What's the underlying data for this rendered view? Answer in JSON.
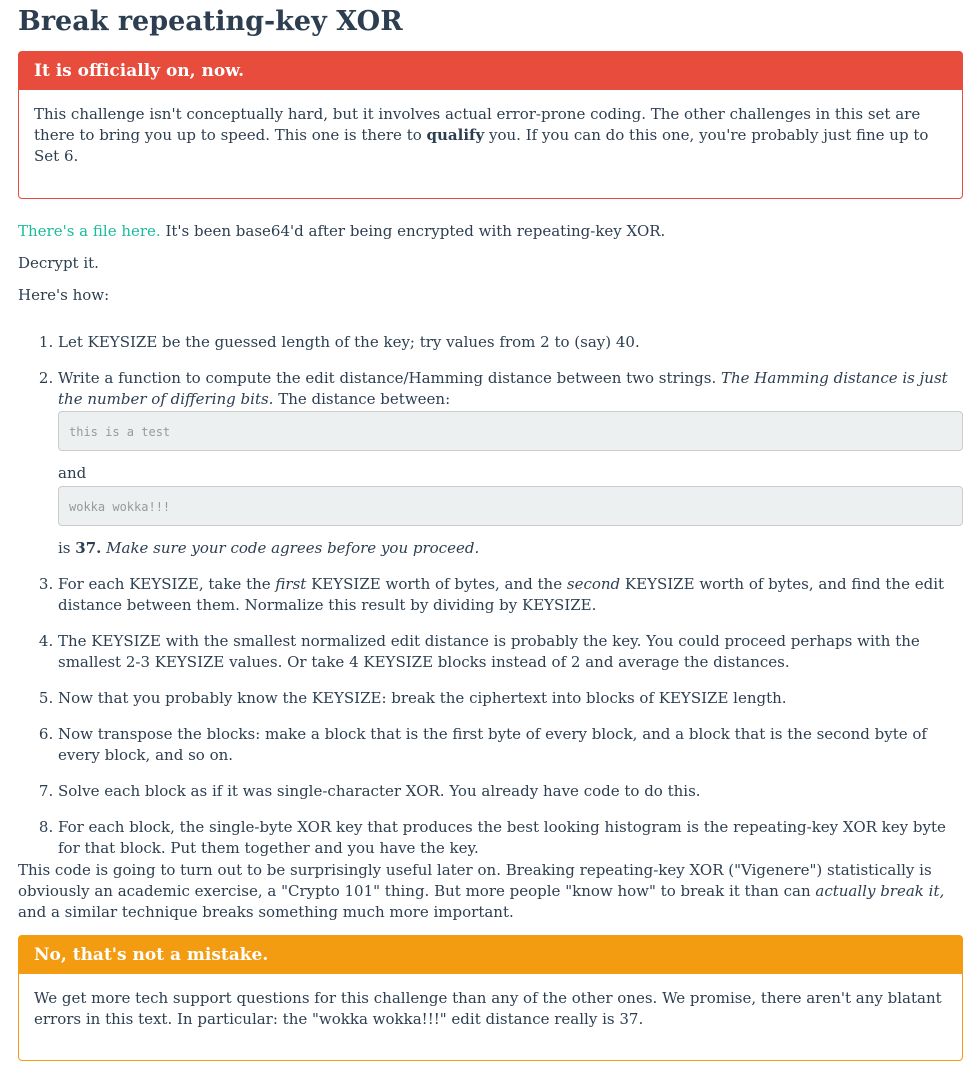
{
  "title": "Break repeating-key XOR",
  "danger_panel": {
    "heading": "It is officially on, now.",
    "body_before": "This challenge isn't conceptually hard, but it involves actual error-prone coding. The other challenges in this set are there to bring you up to speed. This one is there to ",
    "body_bold": "qualify",
    "body_after": " you. If you can do this one, you're probably just fine up to Set 6."
  },
  "intro": {
    "link_text": "There's a file here.",
    "line1_rest": " It's been base64'd after being encrypted with repeating-key XOR.",
    "line2": "Decrypt it.",
    "line3": "Here's how:"
  },
  "steps": {
    "s1": "Let KEYSIZE be the guessed length of the key; try values from 2 to (say) 40.",
    "s2_text": "Write a function to compute the edit distance/Hamming distance between two strings. ",
    "s2_italic": "The Hamming distance is just the number of differing bits.",
    "s2_after": " The distance between:",
    "s2_code1": "this is a test",
    "s2_and": "and",
    "s2_code2": "wokka wokka!!!",
    "s2_is": "is ",
    "s2_num": "37.",
    "s2_tail": " Make sure your code agrees before you proceed.",
    "s3_a": "For each KEYSIZE, take the ",
    "s3_first": "first",
    "s3_b": " KEYSIZE worth of bytes, and the ",
    "s3_second": "second",
    "s3_c": " KEYSIZE worth of bytes, and find the edit distance between them. Normalize this result by dividing by KEYSIZE.",
    "s4": "The KEYSIZE with the smallest normalized edit distance is probably the key. You could proceed perhaps with the smallest 2-3 KEYSIZE values. Or take 4 KEYSIZE blocks instead of 2 and average the distances.",
    "s5": "Now that you probably know the KEYSIZE: break the ciphertext into blocks of KEYSIZE length.",
    "s6": "Now transpose the blocks: make a block that is the first byte of every block, and a block that is the second byte of every block, and so on.",
    "s7": "Solve each block as if it was single-character XOR. You already have code to do this.",
    "s8": "For each block, the single-byte XOR key that produces the best looking histogram is the repeating-key XOR key byte for that block. Put them together and you have the key."
  },
  "outro": {
    "a": "This code is going to turn out to be surprisingly useful later on. Breaking repeating-key XOR (\"Vigenere\") statistically is obviously an academic exercise, a \"Crypto 101\" thing. But more people \"know how\" to break it than can ",
    "italic": "actually break it,",
    "b": " and a similar technique breaks something much more important."
  },
  "warning_panel": {
    "heading": "No, that's not a mistake.",
    "body": "We get more tech support questions for this challenge than any of the other ones. We promise, there aren't any blatant errors in this text. In particular: the \"wokka wokka!!!\" edit distance really is 37."
  },
  "colors": {
    "danger": "#e74c3c",
    "warning": "#f39c12",
    "link": "#18bc9c",
    "text": "#2c3e50"
  }
}
